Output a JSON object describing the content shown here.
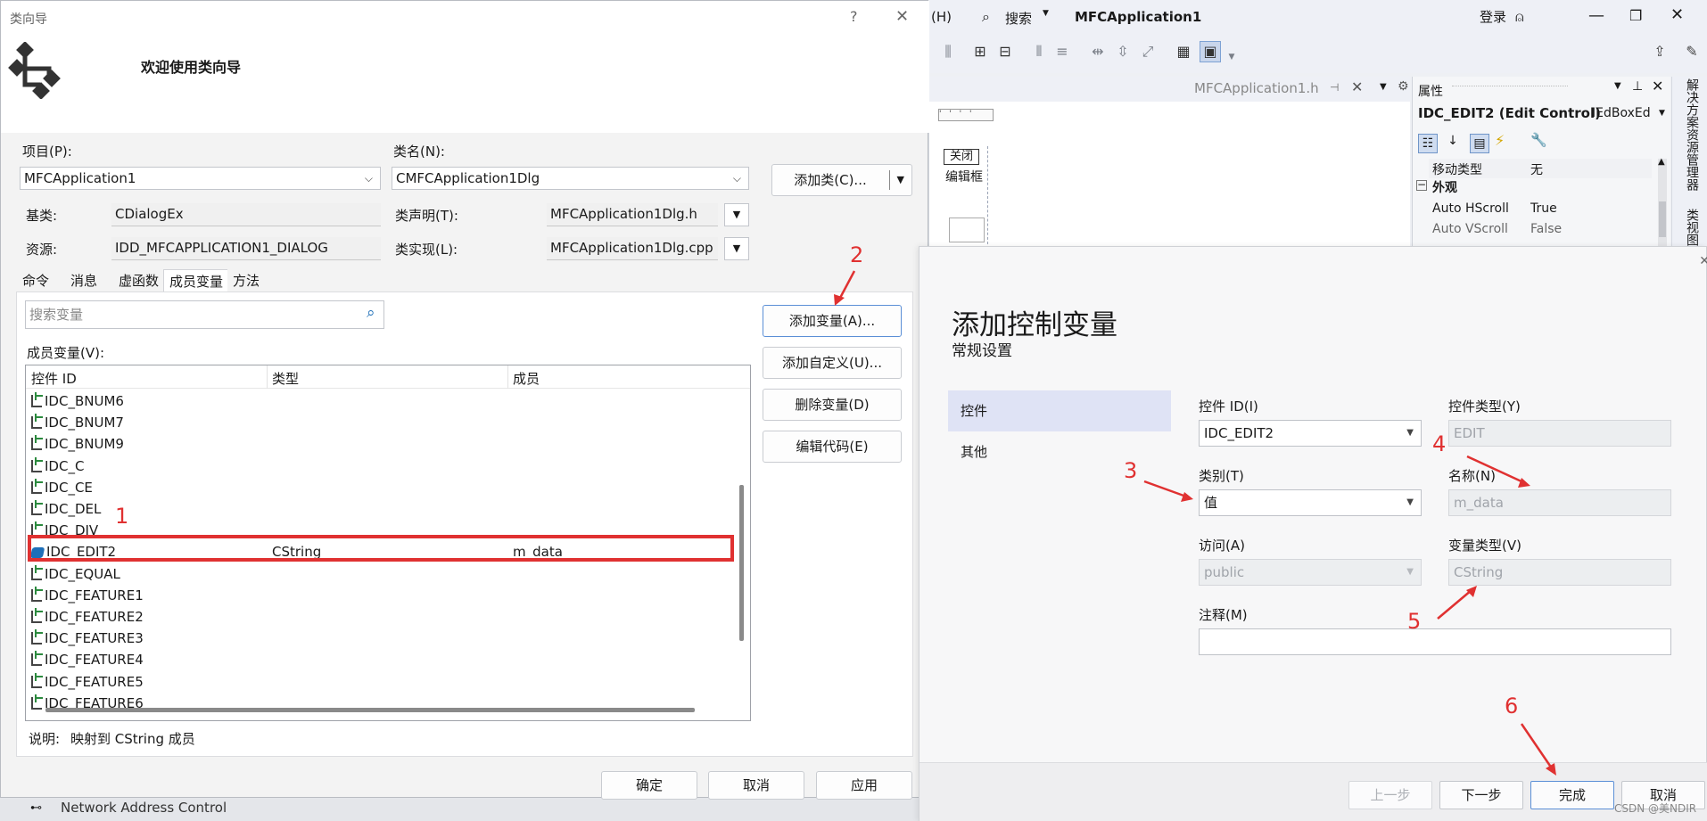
{
  "vs": {
    "menu_help": "(H)",
    "search_label": "搜索",
    "solution_name": "MFCApplication1",
    "login": "登录",
    "doc_tab": "MFCApplication1.h",
    "close_btn_label": "关闭",
    "edit_box_text": "编辑框",
    "bottom_item": "Network Address Control",
    "properties": {
      "title": "属性",
      "object": "IDC_EDIT2 (Edit Control)",
      "object_type": "IEdBoxEd",
      "rows": [
        {
          "name": "移动类型",
          "value": "无"
        },
        {
          "name": "外观",
          "value": ""
        },
        {
          "name": "Auto HScroll",
          "value": "True"
        },
        {
          "name": "Auto VScroll",
          "value": "False"
        }
      ]
    },
    "side_tabs": [
      "解决方案资源管理器",
      "类视图"
    ]
  },
  "wizard": {
    "title": "类向导",
    "help_glyph": "?",
    "close_glyph": "✕",
    "welcome": "欢迎使用类向导",
    "project_label": "项目(P):",
    "project_value": "MFCApplication1",
    "class_label": "类名(N):",
    "class_value": "CMFCApplication1Dlg",
    "add_class": "添加类(C)...",
    "base_label": "基类:",
    "base_value": "CDialogEx",
    "decl_label": "类声明(T):",
    "decl_value": "MFCApplication1Dlg.h",
    "resource_label": "资源:",
    "resource_value": "IDD_MFCAPPLICATION1_DIALOG",
    "impl_label": "类实现(L):",
    "impl_value": "MFCApplication1Dlg.cpp",
    "tabs": [
      "命令",
      "消息",
      "虚函数",
      "成员变量",
      "方法"
    ],
    "search_placeholder": "搜索变量",
    "members_label": "成员变量(V):",
    "columns": [
      "控件 ID",
      "类型",
      "成员"
    ],
    "rows": [
      {
        "id": "IDC_BNUM6",
        "type": "",
        "member": ""
      },
      {
        "id": "IDC_BNUM7",
        "type": "",
        "member": ""
      },
      {
        "id": "IDC_BNUM9",
        "type": "",
        "member": ""
      },
      {
        "id": "IDC_C",
        "type": "",
        "member": ""
      },
      {
        "id": "IDC_CE",
        "type": "",
        "member": ""
      },
      {
        "id": "IDC_DEL",
        "type": "",
        "member": ""
      },
      {
        "id": "IDC_DIV",
        "type": "",
        "member": ""
      },
      {
        "id": "IDC_EDIT2",
        "type": "CString",
        "member": "m_data"
      },
      {
        "id": "IDC_EQUAL",
        "type": "",
        "member": ""
      },
      {
        "id": "IDC_FEATURE1",
        "type": "",
        "member": ""
      },
      {
        "id": "IDC_FEATURE2",
        "type": "",
        "member": ""
      },
      {
        "id": "IDC_FEATURE3",
        "type": "",
        "member": ""
      },
      {
        "id": "IDC_FEATURE4",
        "type": "",
        "member": ""
      },
      {
        "id": "IDC_FEATURE5",
        "type": "",
        "member": ""
      },
      {
        "id": "IDC_FEATURE6",
        "type": "",
        "member": ""
      }
    ],
    "add_var": "添加变量(A)...",
    "add_custom": "添加自定义(U)...",
    "delete_var": "删除变量(D)",
    "edit_code": "编辑代码(E)",
    "desc_label": "说明:",
    "desc_value": "映射到 CString 成员",
    "ok": "确定",
    "cancel": "取消",
    "apply": "应用"
  },
  "addvar": {
    "title": "添加控制变量",
    "subtitle": "常规设置",
    "nav": [
      "控件",
      "其他"
    ],
    "control_id_label": "控件 ID(I)",
    "control_id_value": "IDC_EDIT2",
    "control_type_label": "控件类型(Y)",
    "control_type_value": "EDIT",
    "category_label": "类别(T)",
    "category_value": "值",
    "name_label": "名称(N)",
    "name_value": "m_data",
    "access_label": "访问(A)",
    "access_value": "public",
    "var_type_label": "变量类型(V)",
    "var_type_value": "CString",
    "comment_label": "注释(M)",
    "comment_value": "",
    "prev": "上一步",
    "next": "下一步",
    "finish": "完成",
    "cancel": "取消"
  },
  "callouts": [
    "1",
    "2",
    "3",
    "4",
    "5",
    "6"
  ],
  "watermark": "CSDN @美NDIR",
  "colors": {
    "highlight": "#e03131",
    "nav_selected": "#dfe3f5"
  }
}
